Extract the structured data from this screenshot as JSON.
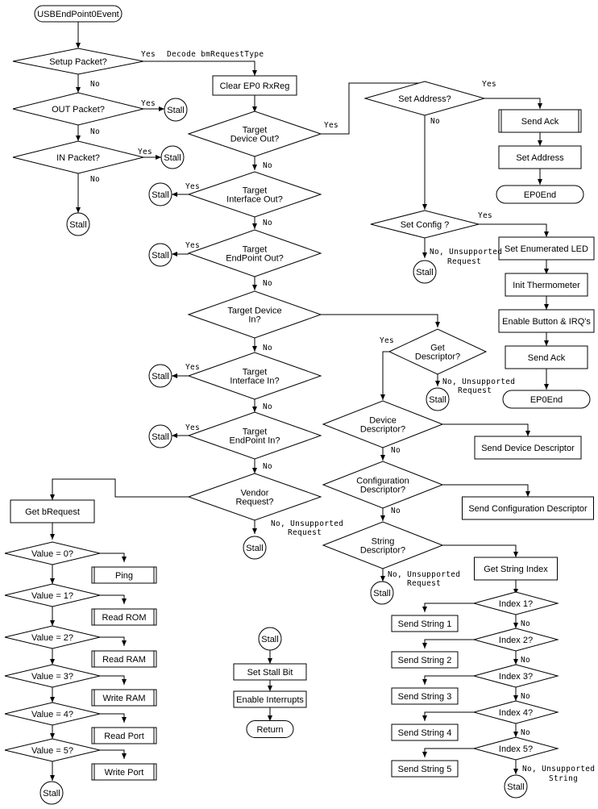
{
  "title": "USBEndPoint0Event",
  "nodes": {
    "start": "USBEndPoint0Event",
    "setup": "Setup Packet?",
    "out_pkt": "OUT Packet?",
    "in_pkt": "IN Packet?",
    "clear_ep0": "Clear EP0 RxReg",
    "tgt_dev_out": [
      "Target",
      "Device Out?"
    ],
    "tgt_if_out": [
      "Target",
      "Interface Out?"
    ],
    "tgt_ep_out": [
      "Target",
      "EndPoint Out?"
    ],
    "tgt_dev_in": [
      "Target Device",
      "In?"
    ],
    "tgt_if_in": [
      "Target",
      "Interface In?"
    ],
    "tgt_ep_in": [
      "Target",
      "EndPoint In?"
    ],
    "vendor": [
      "Vendor",
      "Request?"
    ],
    "set_address_q": "Set Address?",
    "send_ack_1": "Send Ack",
    "set_address": "Set Address",
    "ep0end_1": "EP0End",
    "set_config_q": "Set Config ?",
    "set_led": "Set Enumerated LED",
    "init_thermo": "Init Thermometer",
    "enable_btn": "Enable Button & IRQ's",
    "send_ack_2": "Send Ack",
    "ep0end_2": "EP0End",
    "get_desc": [
      "Get",
      "Descriptor?"
    ],
    "dev_desc_q": [
      "Device",
      "Descriptor?"
    ],
    "send_dev_desc": "Send Device Descriptor",
    "cfg_desc_q": [
      "Configuration",
      "Descriptor?"
    ],
    "send_cfg_desc": "Send Configuration Descriptor",
    "str_desc_q": [
      "String",
      "Descriptor?"
    ],
    "get_str_idx": "Get String Index",
    "index_q": [
      "Index 1?",
      "Index 2?",
      "Index 3?",
      "Index 4?",
      "Index 5?"
    ],
    "send_string": [
      "Send String 1",
      "Send String 2",
      "Send String 3",
      "Send String 4",
      "Send String 5"
    ],
    "get_brequest": "Get bRequest",
    "value_q": [
      "Value = 0?",
      "Value = 1?",
      "Value = 2?",
      "Value = 3?",
      "Value = 4?",
      "Value = 5?"
    ],
    "vendor_actions": [
      "Ping",
      "Read ROM",
      "Read RAM",
      "Write RAM",
      "Read Port",
      "Write Port"
    ],
    "stall": "Stall",
    "set_stall_bit": "Set Stall Bit",
    "enable_interrupts": "Enable Interrupts",
    "return": "Return"
  },
  "labels": {
    "yes": "Yes",
    "no": "No",
    "decode": "Decode bmRequestType",
    "no_unsupported": "No, Unsupported",
    "request": "Request",
    "string": "String"
  }
}
